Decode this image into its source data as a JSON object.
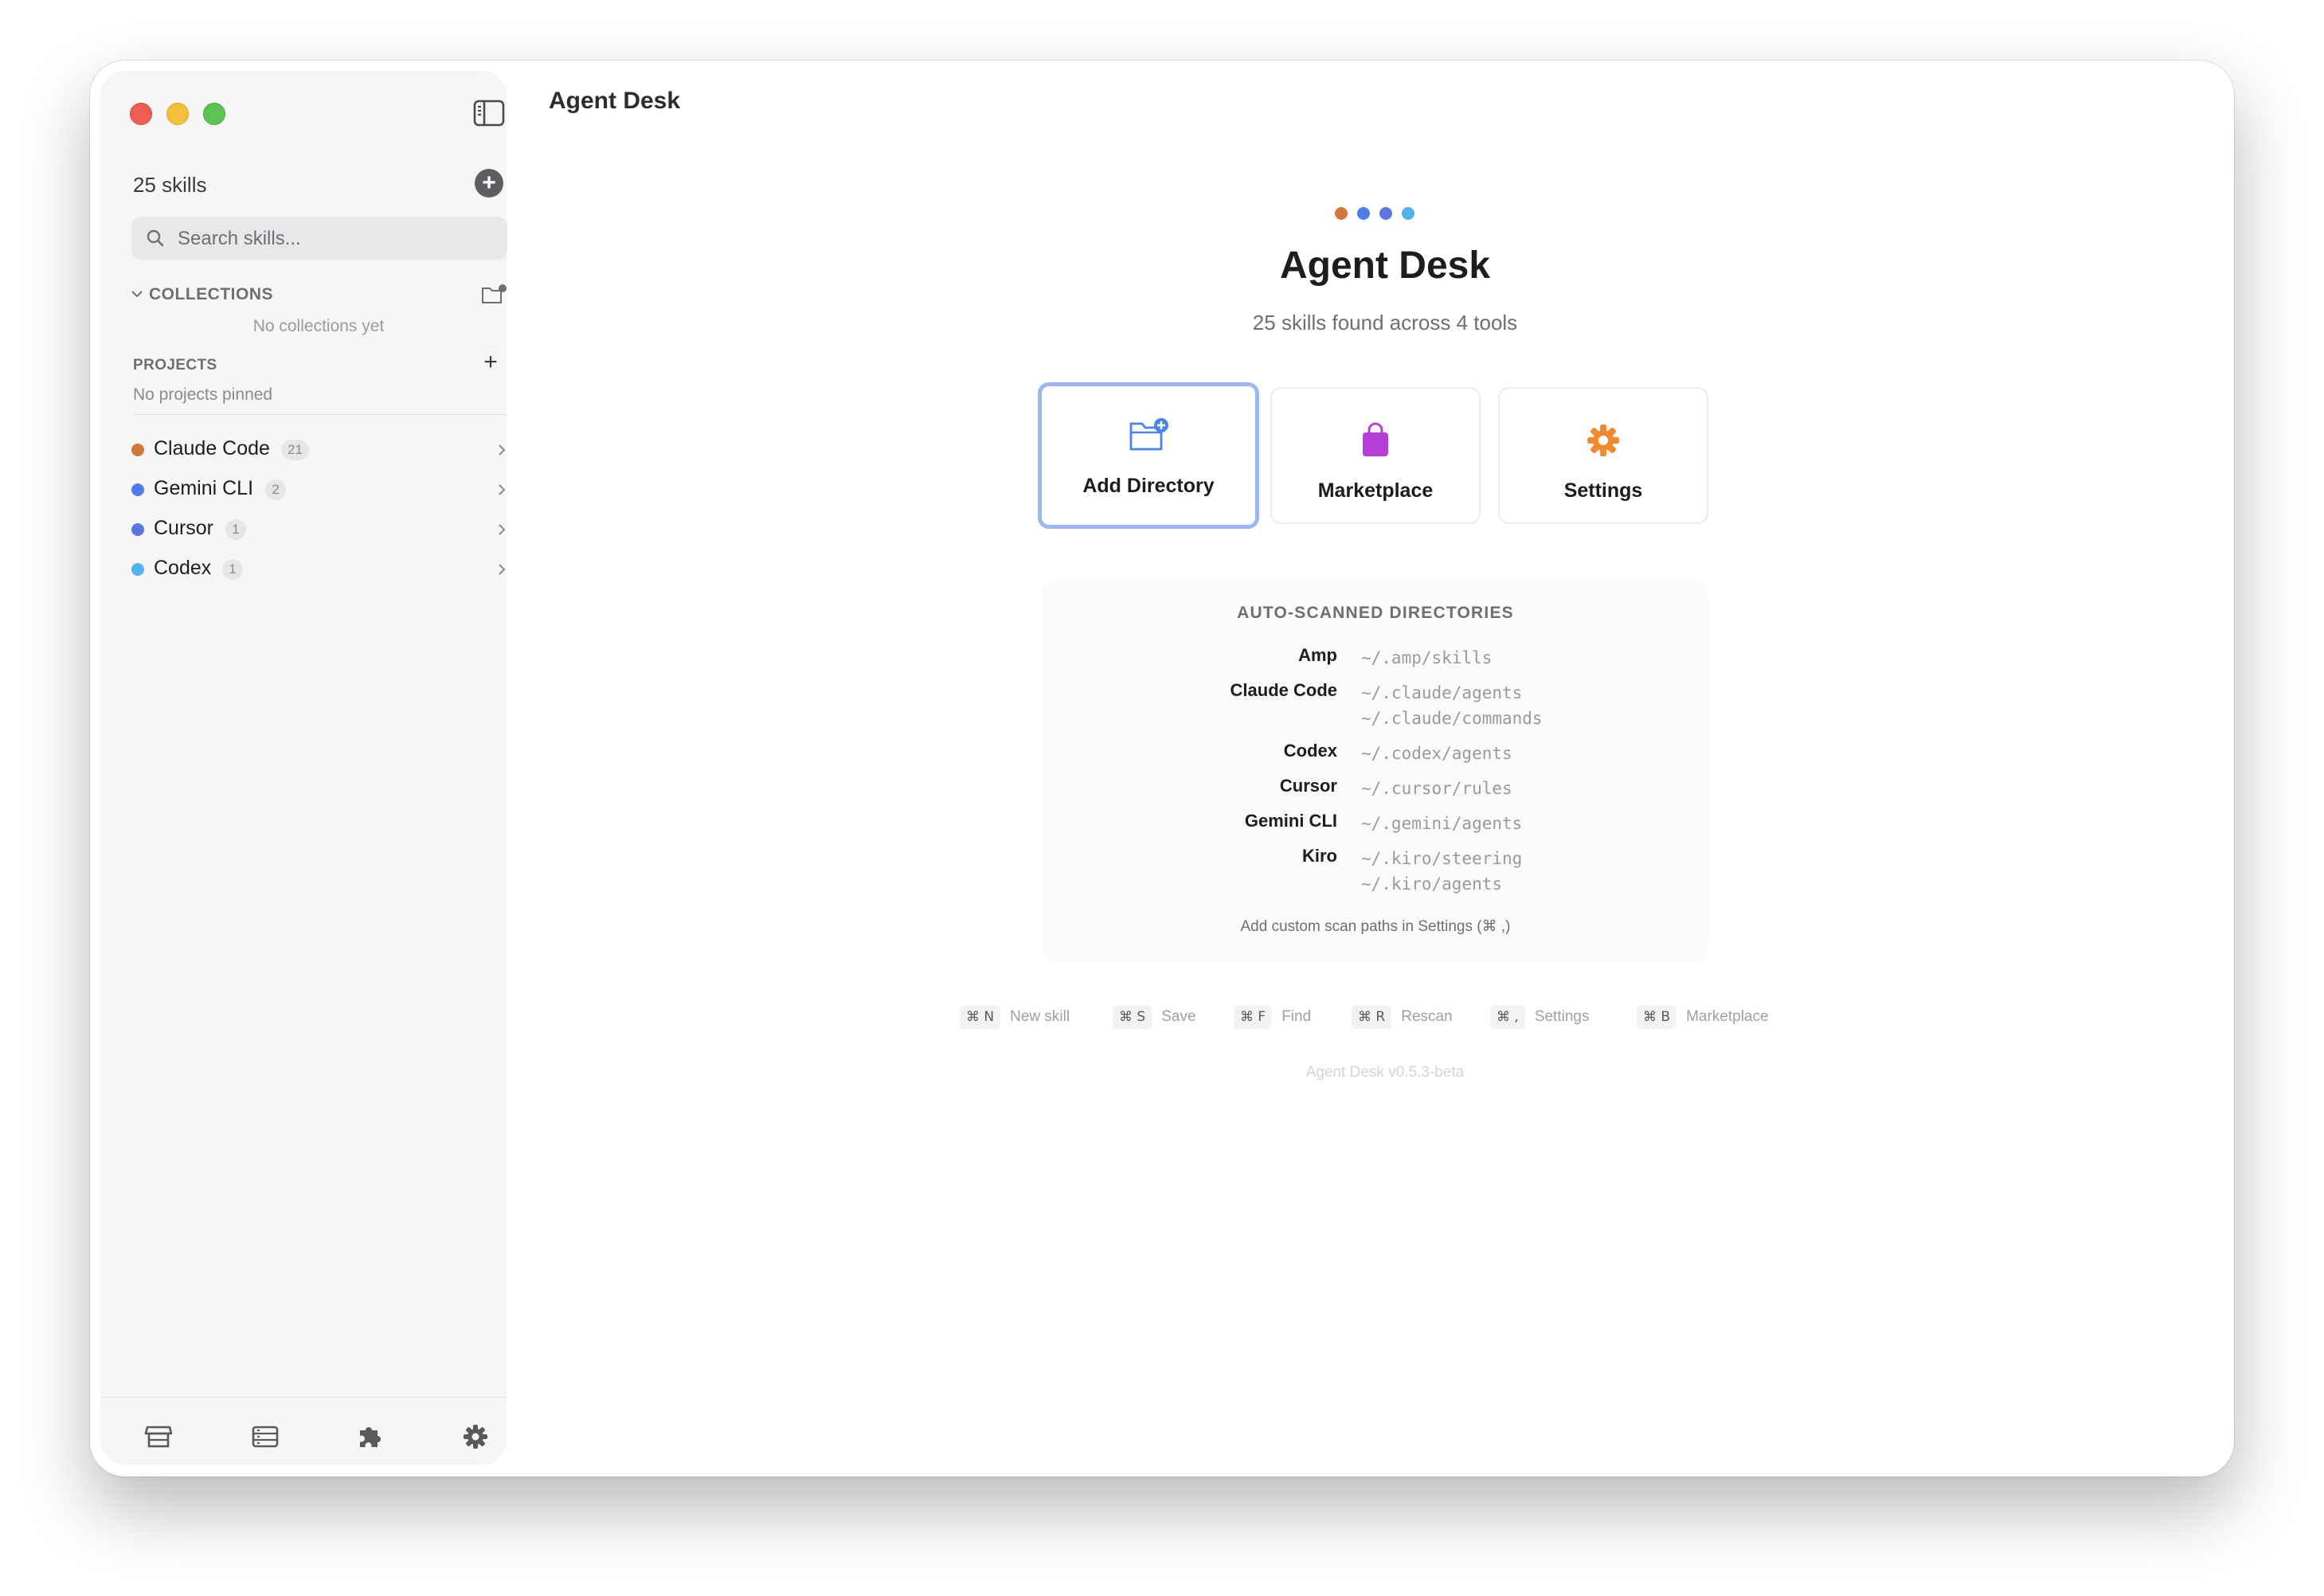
{
  "app": {
    "title": "Agent Desk"
  },
  "sidebar": {
    "skills_count": "25 skills",
    "add_skill_label": "+",
    "search": {
      "placeholder": "Search skills...",
      "value": ""
    },
    "collections": {
      "title": "COLLECTIONS",
      "empty_text": "No collections yet"
    },
    "projects": {
      "title": "PROJECTS",
      "add_label": "+",
      "empty_text": "No projects pinned"
    },
    "tools": [
      {
        "name": "Claude Code",
        "count": "21",
        "color": "#d0783a"
      },
      {
        "name": "Gemini CLI",
        "count": "2",
        "color": "#4f7ce8"
      },
      {
        "name": "Cursor",
        "count": "1",
        "color": "#5a77e0"
      },
      {
        "name": "Codex",
        "count": "1",
        "color": "#4fb3ec"
      }
    ],
    "footer_icons": [
      "store-icon",
      "list-icon",
      "puzzle-icon",
      "gear-icon"
    ]
  },
  "hero": {
    "dot_colors": [
      "#d0783a",
      "#4f7ce8",
      "#5a77e0",
      "#4fb3ec"
    ],
    "title": "Agent Desk",
    "subtitle": "25 skills found across 4 tools"
  },
  "actions": [
    {
      "label": "Add Directory",
      "icon": "folder-plus-icon",
      "color": "#4a84e8",
      "selected": true
    },
    {
      "label": "Marketplace",
      "icon": "shopping-bag-icon",
      "color": "#b43fd9",
      "selected": false
    },
    {
      "label": "Settings",
      "icon": "gear-icon",
      "color": "#f08a2c",
      "selected": false
    }
  ],
  "scan": {
    "title": "AUTO-SCANNED DIRECTORIES",
    "rows": [
      {
        "tool": "Amp",
        "paths": [
          "~/.amp/skills"
        ]
      },
      {
        "tool": "Claude Code",
        "paths": [
          "~/.claude/agents",
          "~/.claude/commands"
        ]
      },
      {
        "tool": "Codex",
        "paths": [
          "~/.codex/agents"
        ]
      },
      {
        "tool": "Cursor",
        "paths": [
          "~/.cursor/rules"
        ]
      },
      {
        "tool": "Gemini CLI",
        "paths": [
          "~/.gemini/agents"
        ]
      },
      {
        "tool": "Kiro",
        "paths": [
          "~/.kiro/steering",
          "~/.kiro/agents"
        ]
      }
    ],
    "footnote": "Add custom scan paths in Settings (⌘ ,)"
  },
  "shortcuts": [
    {
      "keys": "⌘ N",
      "label": "New skill"
    },
    {
      "keys": "⌘ S",
      "label": "Save"
    },
    {
      "keys": "⌘ F",
      "label": "Find"
    },
    {
      "keys": "⌘ R",
      "label": "Rescan"
    },
    {
      "keys": "⌘ ,",
      "label": "Settings"
    },
    {
      "keys": "⌘ B",
      "label": "Marketplace"
    }
  ],
  "version": "Agent Desk v0.5.3-beta"
}
